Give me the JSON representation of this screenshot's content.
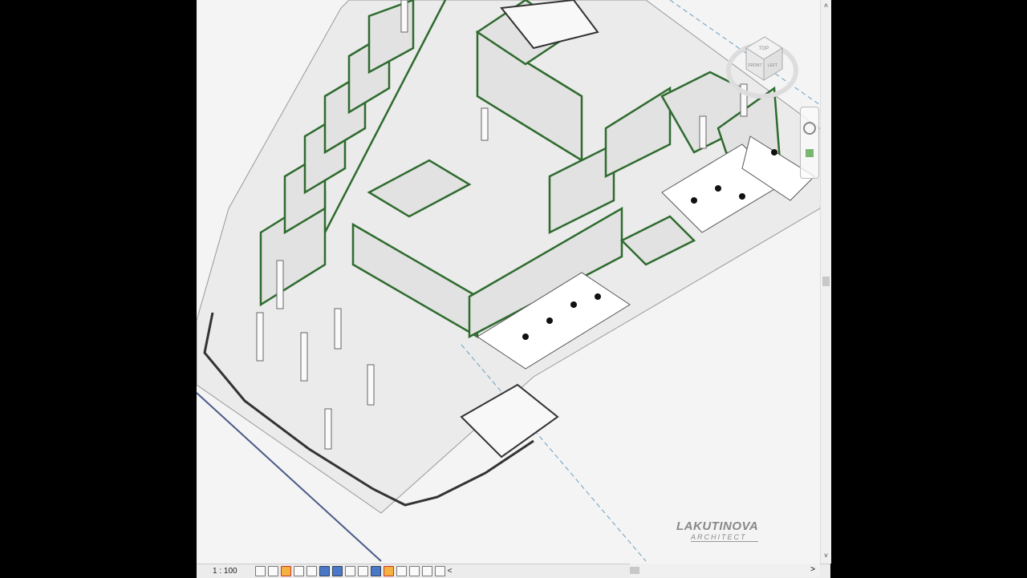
{
  "status_bar": {
    "scale": "1 : 100"
  },
  "viewcube": {
    "faces": [
      "TOP",
      "FRONT",
      "LEFT"
    ]
  },
  "watermark": {
    "line1": "LAKUTINOVA",
    "line2": "ARCHITECT"
  },
  "colors": {
    "wall_outline": "#2e6b2e",
    "wall_fill": "#e6e6e6",
    "background": "#f4f4f4"
  },
  "scrollbars": {
    "up": "˄",
    "down": "˅",
    "left": "<",
    "right": ">"
  }
}
